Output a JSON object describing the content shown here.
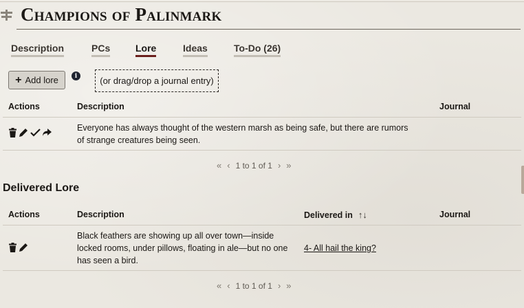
{
  "header": {
    "title": "Champions of Palinmark"
  },
  "tabs": [
    {
      "label": "Description",
      "active": false
    },
    {
      "label": "PCs",
      "active": false
    },
    {
      "label": "Lore",
      "active": true
    },
    {
      "label": "Ideas",
      "active": false
    },
    {
      "label": "To-Do (26)",
      "active": false
    }
  ],
  "toolbar": {
    "add_label": "Add lore",
    "info_icon": "info-icon",
    "drop_text": "(or drag/drop a journal entry)"
  },
  "lore_table": {
    "headers": {
      "actions": "Actions",
      "description": "Description",
      "journal": "Journal"
    },
    "rows": [
      {
        "description": "Everyone has always thought of the western marsh as being safe, but there are rumors of strange creatures being seen.",
        "journal": "",
        "actions": [
          "trash-icon",
          "pencil-icon",
          "check-icon",
          "share-icon"
        ]
      }
    ],
    "pagination": {
      "first": "«",
      "prev": "‹",
      "text": "1 to 1 of 1",
      "next": "›",
      "last": "»"
    }
  },
  "delivered": {
    "title": "Delivered Lore",
    "headers": {
      "actions": "Actions",
      "description": "Description",
      "delivered_in": "Delivered in",
      "journal": "Journal"
    },
    "sort_icon": "↑↓",
    "rows": [
      {
        "description": "Black feathers are showing up all over town—inside locked rooms, under pillows, floating in ale—but no one has seen a bird.",
        "delivered_in": "4- All hail the king?",
        "journal": "",
        "actions": [
          "trash-icon",
          "pencil-icon"
        ]
      }
    ],
    "pagination": {
      "first": "«",
      "prev": "‹",
      "text": "1 to 1 of 1",
      "next": "›",
      "last": "»"
    }
  },
  "colors": {
    "accent": "#6a1f1c",
    "background": "#ebe8e1",
    "text": "#1b1815"
  }
}
